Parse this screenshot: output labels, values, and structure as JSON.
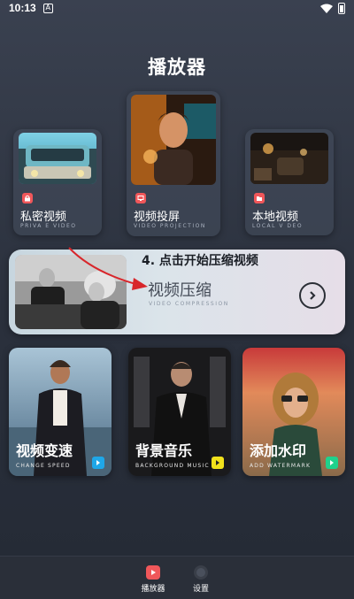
{
  "status_bar": {
    "time": "10:13",
    "notif_glyph": "A"
  },
  "page": {
    "title": "播放器"
  },
  "top_cards": [
    {
      "label": "私密视频",
      "sub": "PRIVA E VIDEO",
      "icon": "lock-icon"
    },
    {
      "label": "视频投屏",
      "sub": "VIDEO PROJECTION",
      "icon": "cast-icon"
    },
    {
      "label": "本地视频",
      "sub": "LOCAL V DEO",
      "icon": "folder-icon"
    }
  ],
  "compress": {
    "label": "视频压缩",
    "sub": "VIDEO COMPRESSION",
    "instruction": "4. 点击开始压缩视频"
  },
  "bottom_cards": [
    {
      "label": "视频变速",
      "sub": "CHANGE SPEED",
      "accent": "#1fa7e8"
    },
    {
      "label": "背景音乐",
      "sub": "BACKGROUND MUSIC",
      "accent": "#f2e21c"
    },
    {
      "label": "添加水印",
      "sub": "ADD WATERMARK",
      "accent": "#1fd18c"
    }
  ],
  "tabs": [
    {
      "label": "播放器",
      "active": true
    },
    {
      "label": "设置",
      "active": false
    }
  ],
  "colors": {
    "accent_red": "#f0575a",
    "annotation_red": "#d8262b"
  }
}
